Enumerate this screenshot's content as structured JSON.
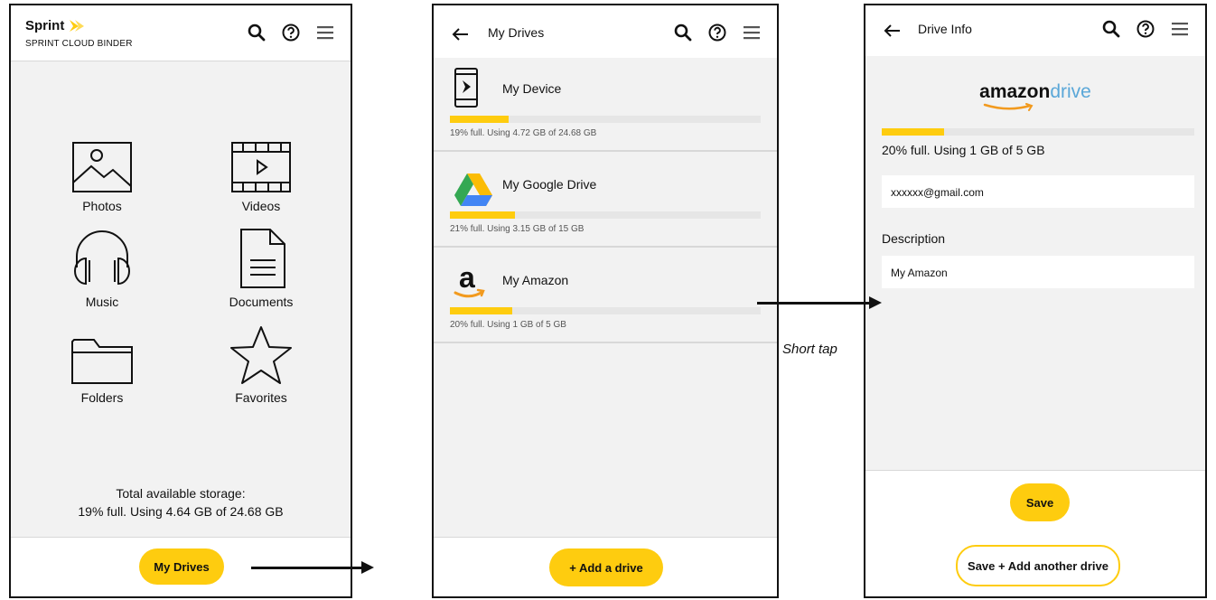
{
  "screen_home": {
    "brand": "Sprint",
    "subtitle": "SPRINT CLOUD BINDER",
    "categories": [
      {
        "label": "Photos",
        "icon": "photo-icon"
      },
      {
        "label": "Videos",
        "icon": "video-icon"
      },
      {
        "label": "Music",
        "icon": "headphones-icon"
      },
      {
        "label": "Documents",
        "icon": "document-icon"
      },
      {
        "label": "Folders",
        "icon": "folder-icon"
      },
      {
        "label": "Favorites",
        "icon": "star-icon"
      }
    ],
    "storage_label": "Total available storage:",
    "storage_value": "19% full. Using 4.64 GB of 24.68 GB",
    "primary_button": "My Drives"
  },
  "screen_drives": {
    "title": "My Drives",
    "drives": [
      {
        "name": "My Device",
        "info": "19% full. Using 4.72 GB of 24.68 GB",
        "percent": 19,
        "icon": "phone-icon"
      },
      {
        "name": "My Google Drive",
        "info": "21% full. Using 3.15 GB of 15 GB",
        "percent": 21,
        "icon": "google-drive-icon"
      },
      {
        "name": "My Amazon",
        "info": "20% full. Using 1 GB of 5 GB",
        "percent": 20,
        "icon": "amazon-icon"
      }
    ],
    "add_button": "+ Add a drive"
  },
  "screen_info": {
    "title": "Drive Info",
    "logo_bold": "amazon",
    "logo_light": "drive",
    "usage": "20% full. Using 1 GB of 5 GB",
    "percent": 20,
    "email_value": "xxxxxx@gmail.com",
    "description_label": "Description",
    "description_value": "My Amazon",
    "save_button": "Save",
    "save_add_button": "Save + Add another drive"
  },
  "annotation": "Short tap",
  "colors": {
    "accent": "#fecc0f",
    "background": "#f2f2f2"
  }
}
